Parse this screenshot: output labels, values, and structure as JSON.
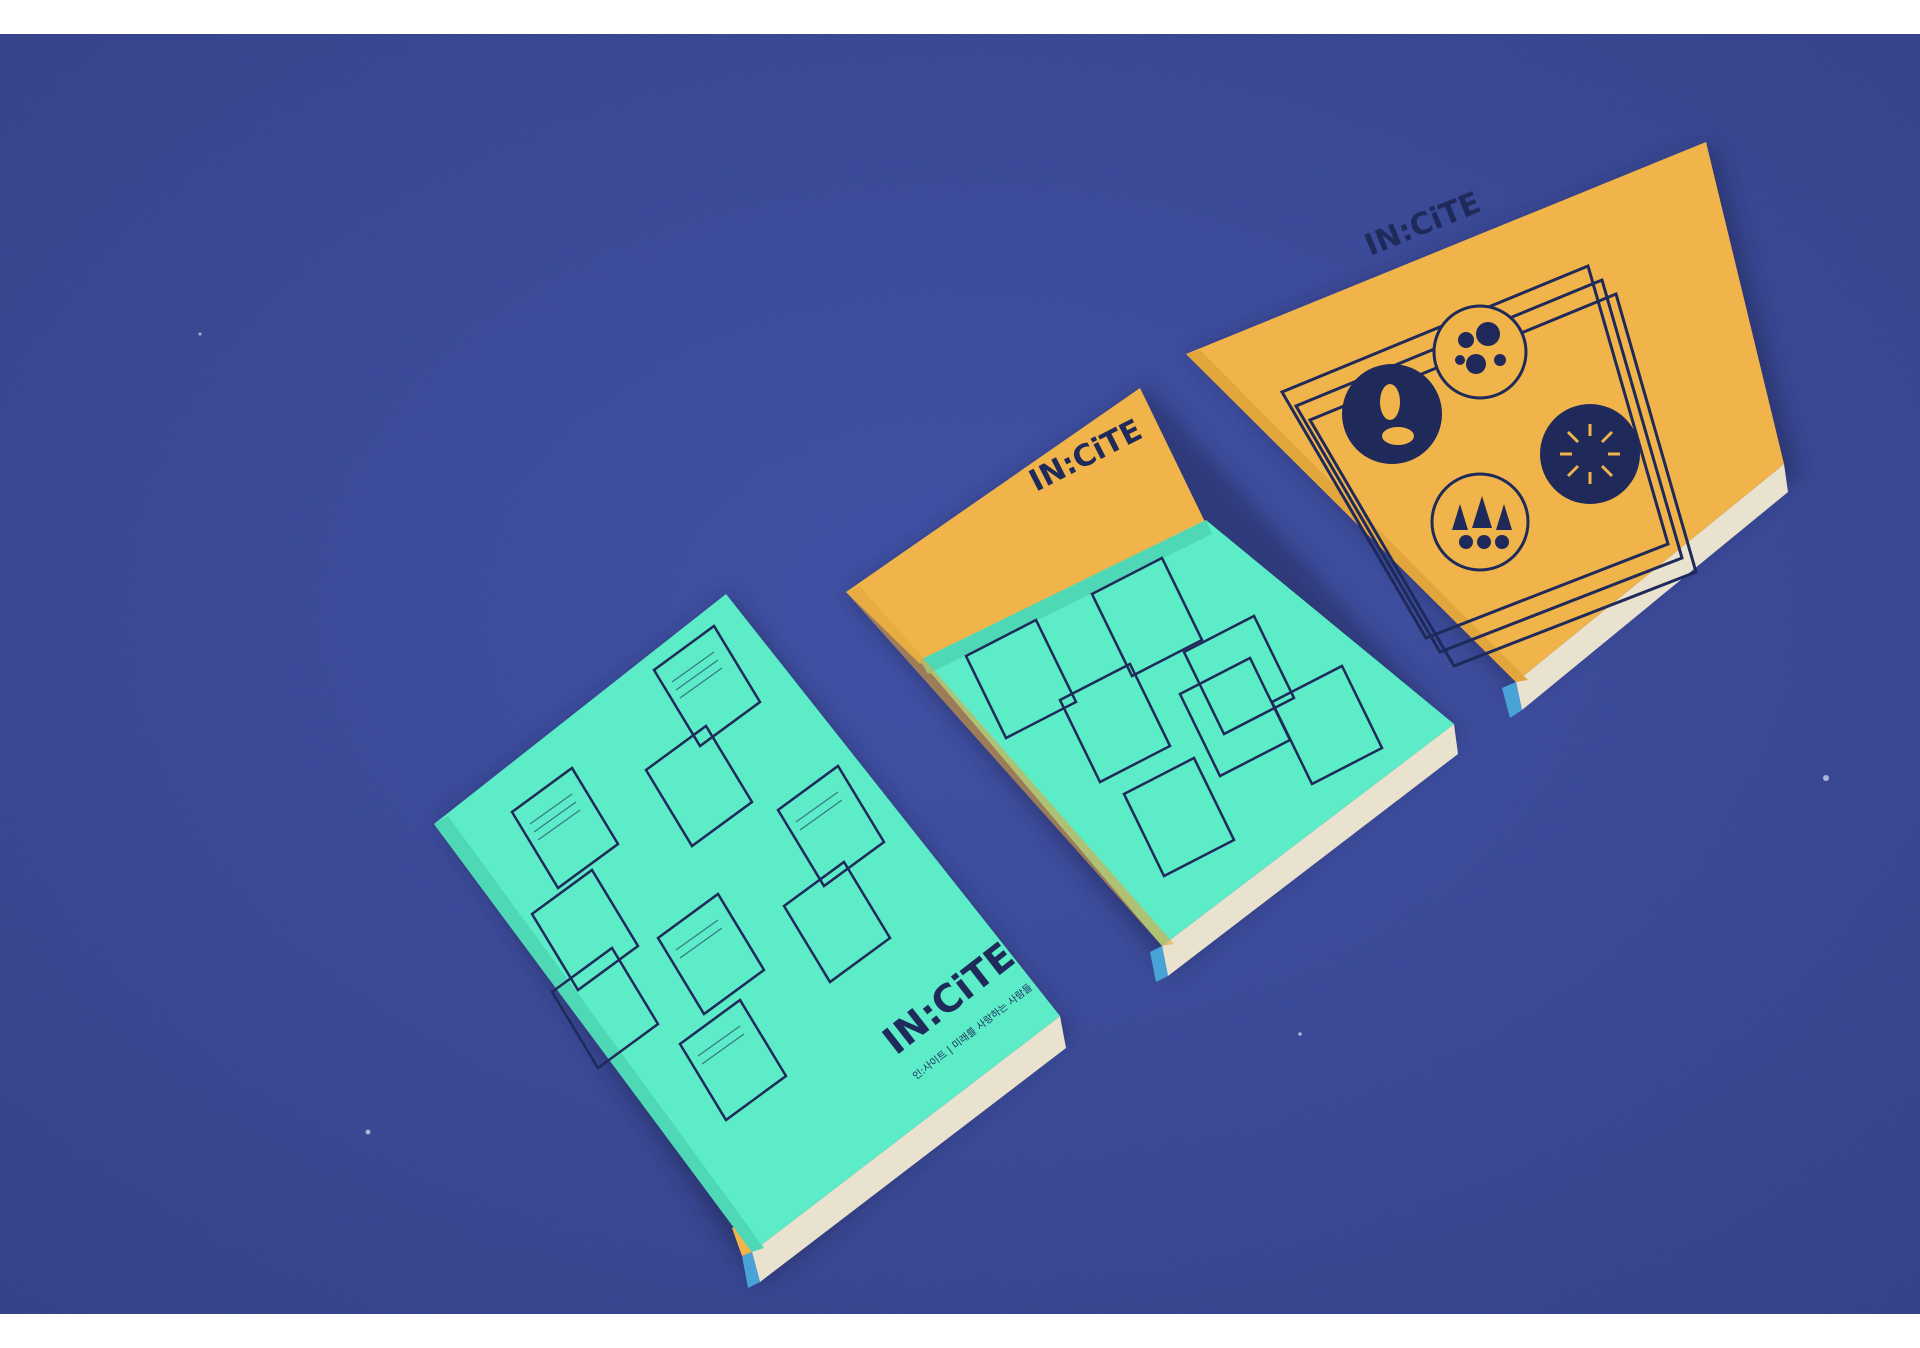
{
  "scene": {
    "background_color": "#3a4a9c",
    "books": [
      {
        "id": "front",
        "cover_color": "#5cecc8",
        "logo": "IN:CiTE",
        "logo_subtitle": "인:사이트 | 미래를 사랑하는 사람들"
      },
      {
        "id": "middle",
        "cover_color": "#5cecc8",
        "band_color": "#f0b44a",
        "logo": "IN:CiTE",
        "logo_subtitle": ""
      },
      {
        "id": "back",
        "cover_color": "#f0b44a",
        "logo": "IN:CiTE",
        "logo_subtitle": ""
      }
    ],
    "line_color": "#1f2a5a",
    "spine_accent": "#4aa3d6"
  }
}
